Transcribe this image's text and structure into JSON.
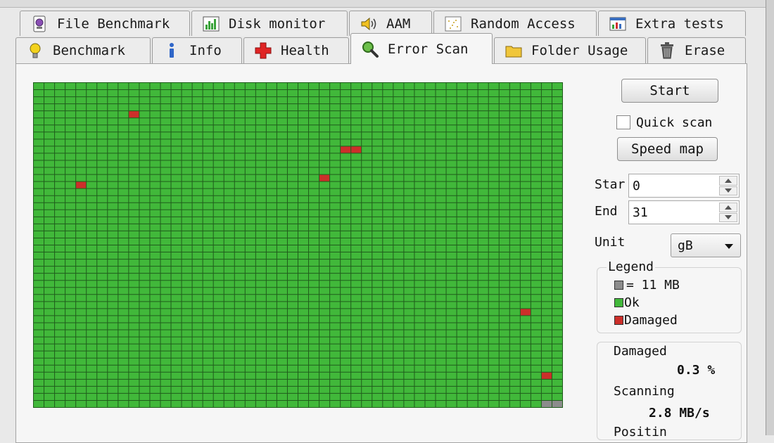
{
  "tabs": {
    "row1": [
      {
        "label": "File Benchmark",
        "icon": "file-benchmark-icon"
      },
      {
        "label": "Disk monitor",
        "icon": "disk-monitor-icon"
      },
      {
        "label": "AAM",
        "icon": "speaker-icon"
      },
      {
        "label": "Random Access",
        "icon": "random-access-icon"
      },
      {
        "label": "Extra tests",
        "icon": "extra-tests-icon"
      }
    ],
    "row2": [
      {
        "label": "Benchmark",
        "icon": "lightbulb-icon"
      },
      {
        "label": "Info",
        "icon": "info-icon"
      },
      {
        "label": "Health",
        "icon": "health-cross-icon"
      },
      {
        "label": "Error Scan",
        "icon": "magnifier-icon",
        "active": true
      },
      {
        "label": "Folder Usage",
        "icon": "folder-icon"
      },
      {
        "label": "Erase",
        "icon": "trash-icon"
      }
    ]
  },
  "controls": {
    "start_label": "Start",
    "quick_scan_label": "Quick scan",
    "quick_scan_checked": false,
    "speed_map_label": "Speed map",
    "start_field_label": "Star",
    "start_value": "0",
    "end_field_label": "End",
    "end_value": "31",
    "unit_label": "Unit",
    "unit_value": "gB"
  },
  "legend": {
    "title": "Legend",
    "block_size": "= 11 MB",
    "ok": "Ok",
    "damaged": "Damaged"
  },
  "stats": {
    "damaged_label": "Damaged",
    "damaged_value": "0.3 %",
    "scanning_label": "Scanning",
    "scanning_value": "2.8 MB/s",
    "position_label": "Positin"
  },
  "scan_map": {
    "columns": 50,
    "rows": 46,
    "damaged_cells": [
      [
        4,
        9
      ],
      [
        9,
        29
      ],
      [
        9,
        30
      ],
      [
        13,
        27
      ],
      [
        14,
        4
      ],
      [
        32,
        46
      ],
      [
        41,
        48
      ]
    ],
    "pending_cells": [
      [
        45,
        48
      ],
      [
        45,
        49
      ]
    ]
  },
  "colors": {
    "ok": "#41b83a",
    "damaged": "#cc2f2a",
    "pending": "#8c8c8c",
    "grid_line": "#205d1c"
  }
}
